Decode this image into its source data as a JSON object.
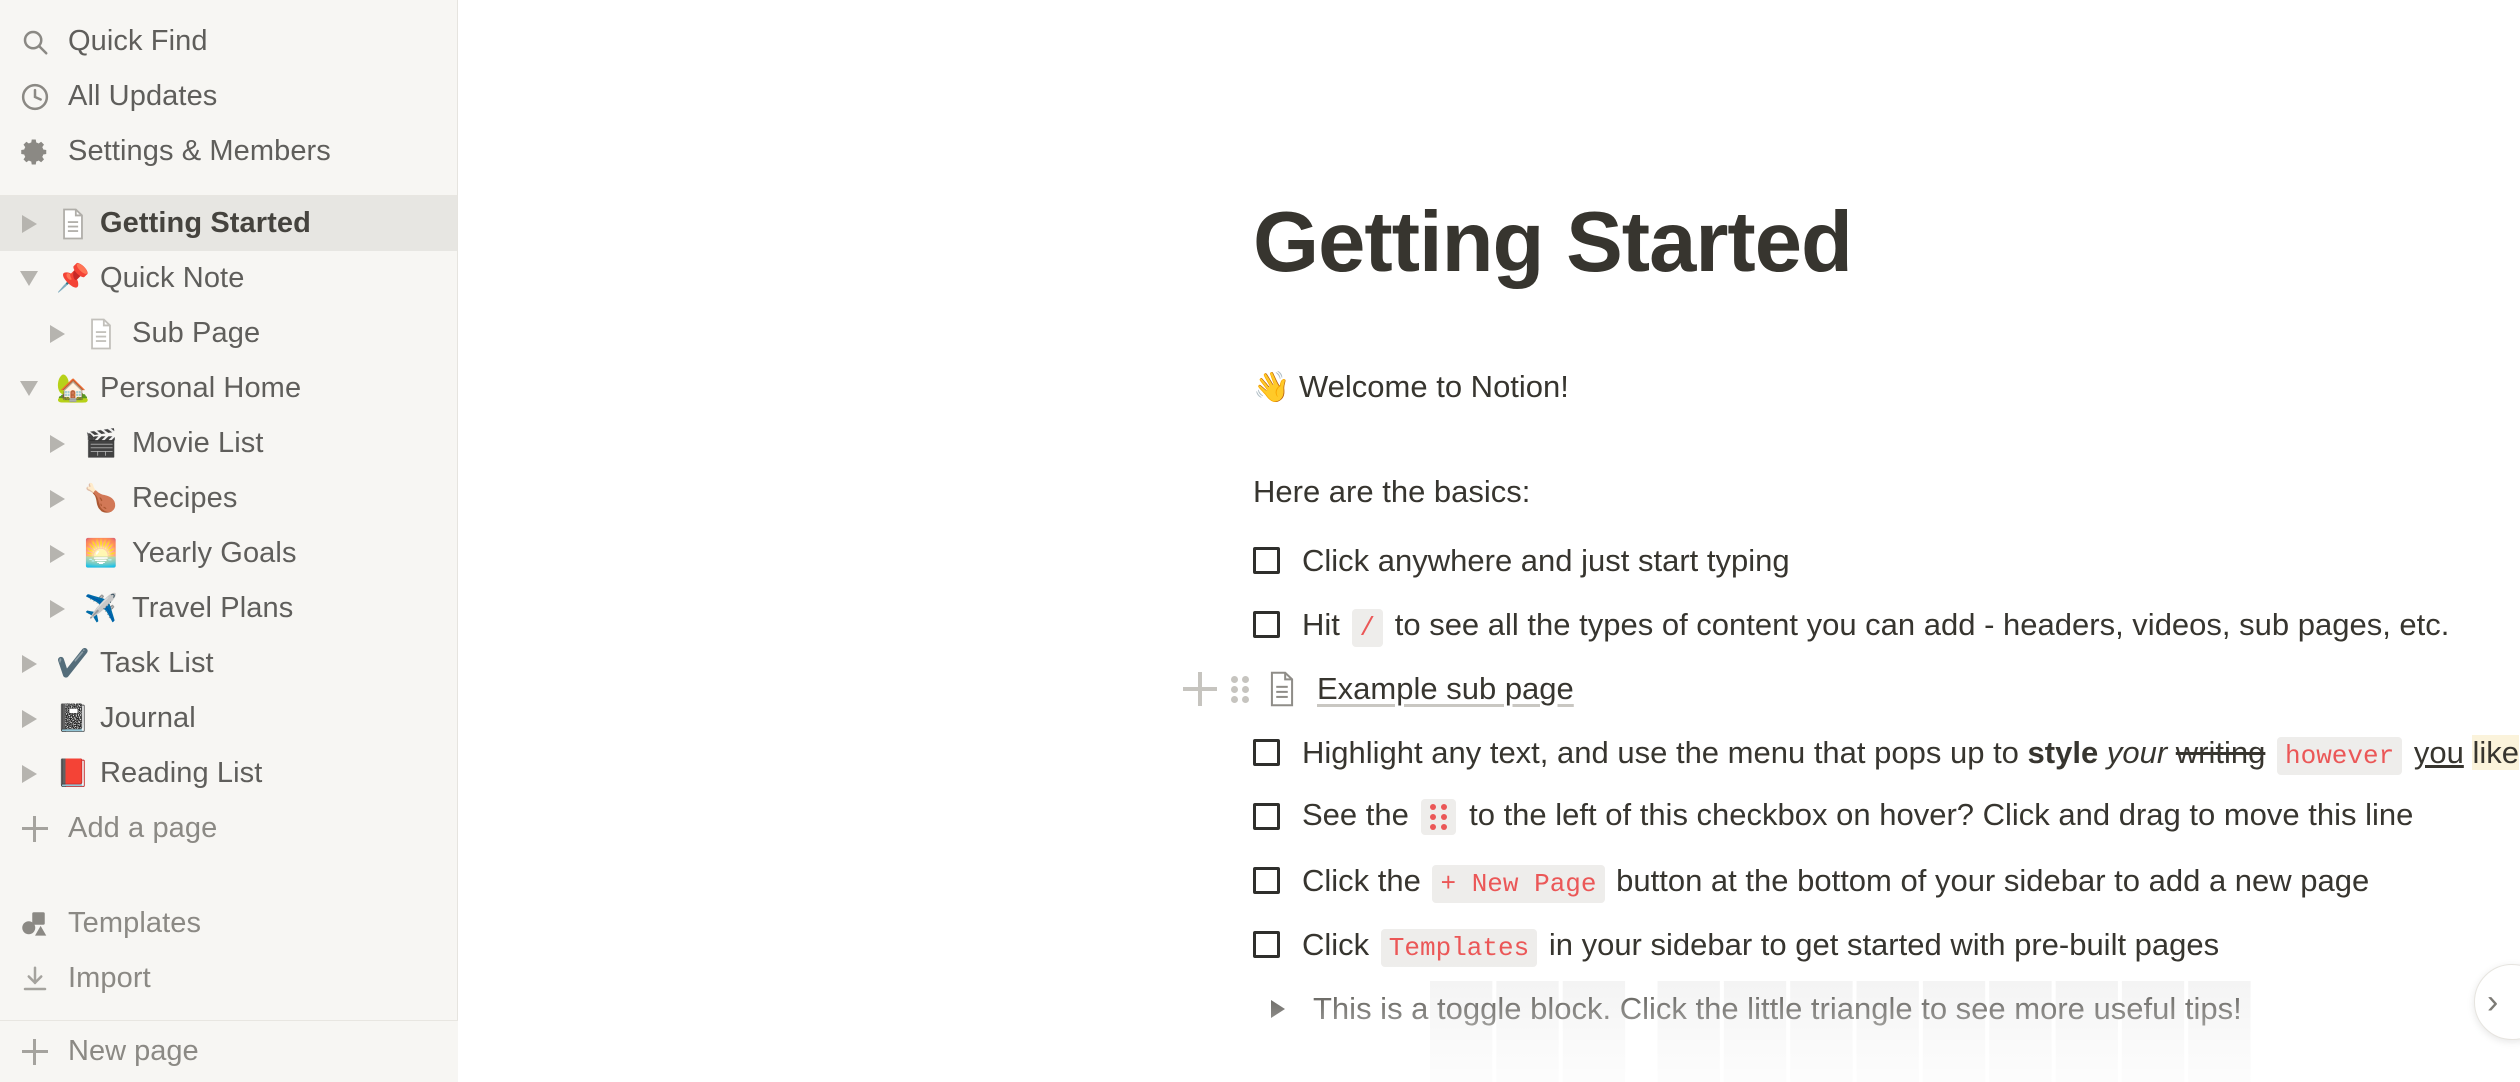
{
  "sidebar": {
    "utility_items": [
      {
        "icon": "search-icon",
        "label": "Quick Find"
      },
      {
        "icon": "clock-icon",
        "label": "All Updates"
      },
      {
        "icon": "gear-icon",
        "label": "Settings & Members"
      }
    ],
    "pages": [
      {
        "label": "Getting Started",
        "icon": "document-icon",
        "emoji": "",
        "expanded": false,
        "indent": 0,
        "selected": true
      },
      {
        "label": "Quick Note",
        "icon": "emoji",
        "emoji": "📌",
        "expanded": true,
        "indent": 0,
        "selected": false
      },
      {
        "label": "Sub Page",
        "icon": "document-icon",
        "emoji": "",
        "expanded": false,
        "indent": 1,
        "selected": false
      },
      {
        "label": "Personal Home",
        "icon": "emoji",
        "emoji": "🏡",
        "expanded": true,
        "indent": 0,
        "selected": false
      },
      {
        "label": "Movie List",
        "icon": "emoji",
        "emoji": "🎬",
        "expanded": false,
        "indent": 1,
        "selected": false
      },
      {
        "label": "Recipes",
        "icon": "emoji",
        "emoji": "🍗",
        "expanded": false,
        "indent": 1,
        "selected": false
      },
      {
        "label": "Yearly Goals",
        "icon": "emoji",
        "emoji": "🌅",
        "expanded": false,
        "indent": 1,
        "selected": false
      },
      {
        "label": "Travel Plans",
        "icon": "emoji",
        "emoji": "✈️",
        "expanded": false,
        "indent": 1,
        "selected": false
      },
      {
        "label": "Task List",
        "icon": "emoji",
        "emoji": "✔️",
        "expanded": false,
        "indent": 0,
        "selected": false
      },
      {
        "label": "Journal",
        "icon": "emoji",
        "emoji": "📓",
        "expanded": false,
        "indent": 0,
        "selected": false
      },
      {
        "label": "Reading List",
        "icon": "emoji",
        "emoji": "📕",
        "expanded": false,
        "indent": 0,
        "selected": false
      }
    ],
    "add_a_page": {
      "icon": "plus-icon",
      "label": "Add a page"
    },
    "templates": {
      "icon": "templates-icon",
      "label": "Templates"
    },
    "import": {
      "icon": "import-icon",
      "label": "Import"
    },
    "footer": {
      "icon": "plus-icon",
      "label": "New page"
    }
  },
  "main": {
    "title": "Getting Started",
    "welcome": {
      "emoji": "👋",
      "text": " Welcome to Notion!"
    },
    "basics_heading": "Here are the basics:",
    "todo_1": {
      "text": "Click anywhere and just start typing"
    },
    "todo_2": {
      "pre": "Hit ",
      "code": "/",
      "post": " to see all the types of content you can add - headers, videos, sub pages, etc."
    },
    "subpage": {
      "label": "Example sub page",
      "icon": "document-icon"
    },
    "todo_3": {
      "pre": "Highlight any text, and use the menu that pops up to ",
      "bold": "style",
      "mid1": " ",
      "italic": "your",
      "mid2": " ",
      "strike": "writing",
      "mid3": " ",
      "code": "however",
      "mid4": " ",
      "underline": "you",
      "mid5": " ",
      "highlight": "like"
    },
    "todo_4": {
      "pre": "See the ",
      "post": " to the left of this checkbox on hover? Click and drag to move this line"
    },
    "todo_5": {
      "pre": "Click the ",
      "code": "+ New Page",
      "post": " button at the bottom of your sidebar to add a new page"
    },
    "todo_6": {
      "pre": "Click ",
      "code": "Templates",
      "post": " in your sidebar to get started with pre-built pages"
    },
    "toggle": {
      "text": "This is a toggle block. Click the little triangle to see more useful tips!"
    },
    "right_fab": {
      "icon": "chevron-right-icon",
      "glyph": "›"
    }
  },
  "colors": {
    "sidebar_bg": "#f7f6f3",
    "sidebar_selected": "#e7e6e2",
    "text_primary": "#37352f",
    "text_muted": "#8b8984",
    "code_red": "#eb5757",
    "code_bg": "#eeedeb",
    "highlight_yellow": "#fbf3db"
  }
}
